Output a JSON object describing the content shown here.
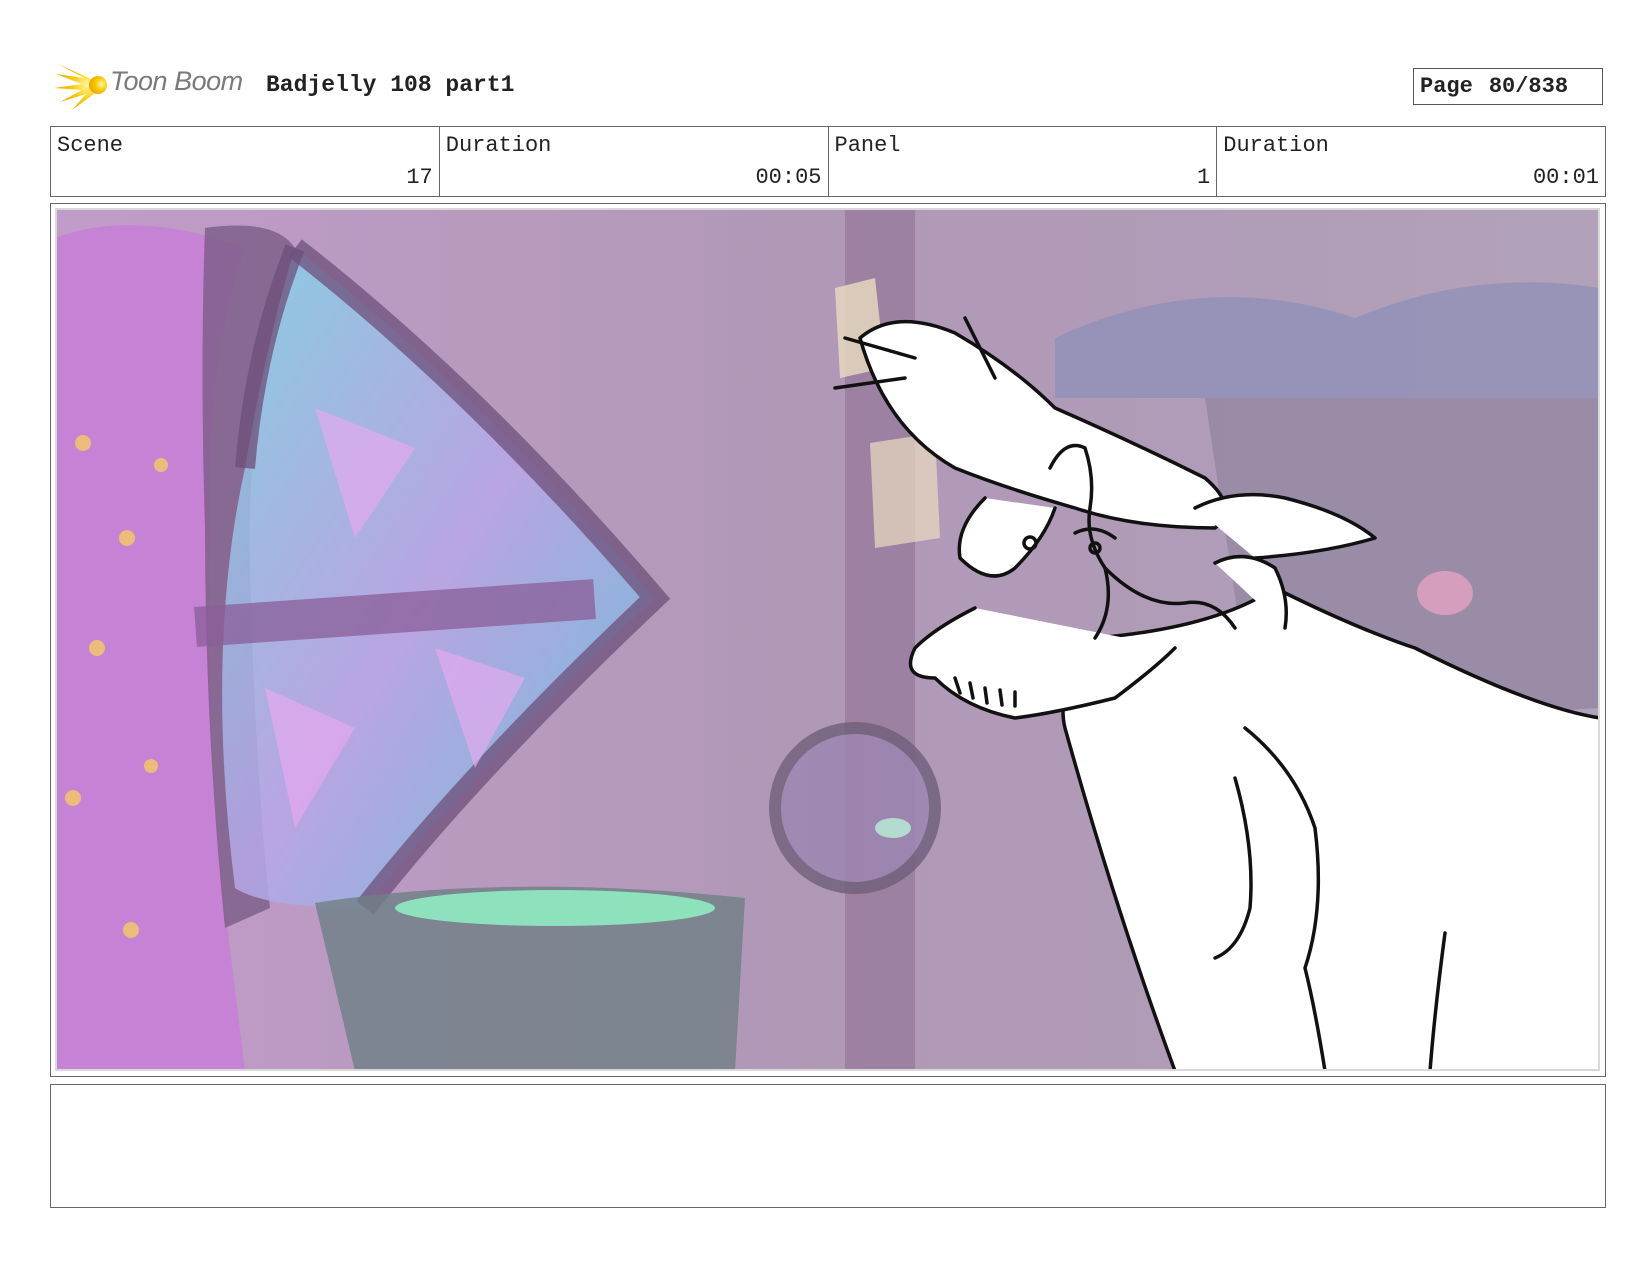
{
  "header": {
    "logo_text": "Toon Boom",
    "project_title": "Badjelly 108 part1",
    "page_label": "Page",
    "page_value": "80/838"
  },
  "info": {
    "scene_label": "Scene",
    "scene_value": "17",
    "scene_duration_label": "Duration",
    "scene_duration_value": "00:05",
    "panel_label": "Panel",
    "panel_value": "1",
    "panel_duration_label": "Duration",
    "panel_duration_value": "00:01"
  },
  "notes": {
    "text": ""
  },
  "colors": {
    "logo_accent": "#f5c400",
    "background_tint": "#9d84a8",
    "sketch_line": "#111111"
  }
}
